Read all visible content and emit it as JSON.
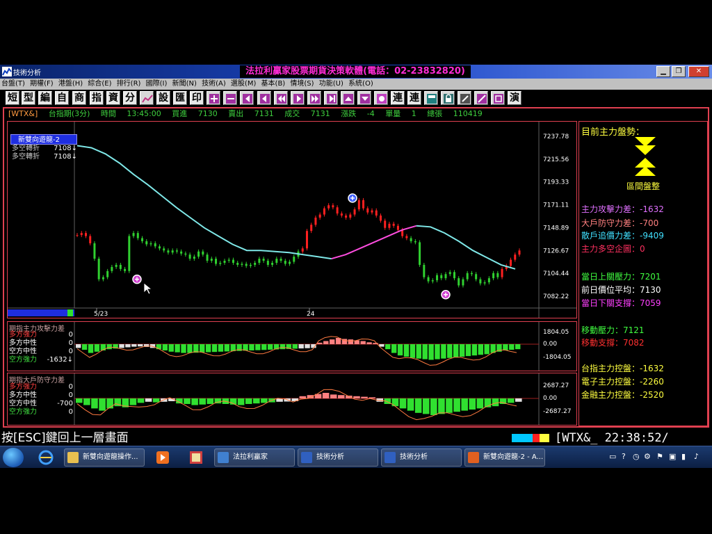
{
  "window": {
    "app_name": "技術分析",
    "title": "法拉利贏家股票期貨決策軟體(電話：02-23832820)"
  },
  "menu": [
    "台盤(T)",
    "期權(F)",
    "港盤(H)",
    "綜合(E)",
    "排行(R)",
    "國際(I)",
    "新聞(N)",
    "技術(A)",
    "選股(M)",
    "基本(B)",
    "情境(S)",
    "功能(U)",
    "系統(O)"
  ],
  "toolbar": {
    "text_buttons": [
      "短",
      "型",
      "編",
      "自",
      "商",
      "指",
      "資",
      "分"
    ],
    "text_buttons_2": [
      "設",
      "匯",
      "印"
    ],
    "text_buttons_3": [
      "連",
      "連"
    ],
    "text_buttons_4": [
      "演"
    ]
  },
  "info": {
    "code": "[WTX&]",
    "name": "台指期(3分)",
    "time_label": "時間",
    "time": "13:45:00",
    "buy_label": "買進",
    "buy": "7130",
    "sell_label": "賣出",
    "sell": "7131",
    "deal_label": "成交",
    "deal": "7131",
    "change_label": "漲跌",
    "change": "-4",
    "qty_label": "單量",
    "qty": "1",
    "total_label": "總張",
    "total": "110419"
  },
  "legend": {
    "indicator": "新雙向遊龍-2",
    "rows": [
      {
        "label": "多空轉折",
        "value": "7108↓"
      },
      {
        "label": "多空轉折",
        "value": "7108↓"
      }
    ]
  },
  "chart_data": [
    {
      "type": "line",
      "title": "",
      "y_ticks": [
        7237.78,
        7215.56,
        7193.33,
        7171.11,
        7148.89,
        7126.67,
        7104.44,
        7082.22
      ],
      "x_labels": [
        "5/23",
        "24"
      ],
      "series": [
        {
          "color": "#7fe8e8",
          "y": [
            7228,
            7226,
            7220,
            7211,
            7200,
            7190,
            7179,
            7168,
            7158,
            7148,
            7140,
            7132,
            7126,
            7126,
            7125,
            7124,
            7122,
            7120,
            7118
          ]
        },
        {
          "color": "#ff4de0",
          "y": [
            7118,
            7122,
            7128,
            7134,
            7140,
            7146,
            7150
          ]
        },
        {
          "color": "#7fe8e8",
          "y": [
            7150,
            7149,
            7143,
            7135,
            7126,
            7119,
            7112,
            7108
          ]
        }
      ],
      "price_path": [
        7141,
        7143,
        7140,
        7133,
        7118,
        7098,
        7100,
        7106,
        7110,
        7112,
        7108,
        7106,
        7140,
        7143,
        7138,
        7135,
        7132,
        7133,
        7130,
        7128,
        7126,
        7124,
        7126,
        7125,
        7123,
        7122,
        7118,
        7120,
        7125,
        7122,
        7116,
        7118,
        7113,
        7114,
        7116,
        7117,
        7114,
        7112,
        7113,
        7111,
        7112,
        7114,
        7118,
        7116,
        7112,
        7114,
        7118,
        7116,
        7113,
        7115,
        7120,
        7125,
        7128,
        7145,
        7151,
        7158,
        7161,
        7167,
        7170,
        7168,
        7162,
        7160,
        7158,
        7161,
        7166,
        7175,
        7167,
        7163,
        7165,
        7160,
        7155,
        7148,
        7152,
        7150,
        7146,
        7140,
        7138,
        7135,
        7134,
        7112,
        7100,
        7096,
        7097,
        7102,
        7099,
        7103,
        7105,
        7099,
        7092,
        7098,
        7104,
        7103,
        7098,
        7094,
        7095,
        7099,
        7104,
        7100,
        7108,
        7111,
        7117,
        7122,
        7126
      ]
    },
    {
      "type": "bar",
      "title": "期指主力攻擊力差",
      "y_ticks": [
        1804.05,
        0.0,
        -1804.05
      ],
      "rows": [
        {
          "label": "多方強力",
          "value": "0",
          "color": "#ff4040"
        },
        {
          "label": "多方中性",
          "value": "0",
          "color": "#ffffff"
        },
        {
          "label": "空方中性",
          "value": "0",
          "color": "#ffffff"
        },
        {
          "label": "空方強力",
          "value": "-1632↓",
          "color": "#40e040"
        }
      ],
      "values": [
        -300,
        -450,
        -700,
        -600,
        -500,
        -400,
        -350,
        -300,
        -250,
        -200,
        -180,
        -220,
        -300,
        -400,
        -500,
        -600,
        -650,
        -700,
        -700,
        -680,
        -660,
        -640,
        -620,
        -600,
        -580,
        -560,
        -540,
        -520,
        -500,
        -480,
        -460,
        -440,
        -420,
        -400,
        -380,
        -360,
        -340,
        -320,
        -300,
        120,
        250,
        380,
        500,
        420,
        380,
        300,
        250,
        150,
        100,
        -200,
        -400,
        -700,
        -900,
        -1000,
        -1100,
        -1150,
        -1200,
        -1250,
        -1200,
        -1150,
        -1100,
        -1050,
        -1000,
        -950,
        -900,
        -850,
        -800,
        -700,
        -600,
        -500,
        -450,
        -400
      ]
    },
    {
      "type": "bar",
      "title": "期指大戶防守力差",
      "y_ticks": [
        2687.27,
        0.0,
        -2687.27
      ],
      "rows": [
        {
          "label": "多方強力",
          "value": "0",
          "color": "#ff4040"
        },
        {
          "label": "多方中性",
          "value": "0",
          "color": "#ffffff"
        },
        {
          "label": "空方中性",
          "value": "-700",
          "color": "#ffffff"
        },
        {
          "label": "空方強力",
          "value": "0",
          "color": "#40e040"
        }
      ],
      "values": [
        -400,
        -600,
        -900,
        -1100,
        -900,
        -700,
        -800,
        -600,
        -400,
        -300,
        -350,
        -300,
        -250,
        -450,
        -500,
        -600,
        -550,
        -500,
        -450,
        -500,
        -550,
        -600,
        -500,
        -450,
        -400,
        -350,
        -300,
        -280,
        -250,
        200,
        300,
        400,
        500,
        350,
        300,
        250,
        200,
        150,
        100,
        -300,
        -500,
        -700,
        -900,
        -1100,
        -1300,
        -1400,
        -1500,
        -1400,
        -1300,
        -1200,
        -1100,
        -1000,
        -900,
        -800,
        -700,
        -500,
        -400,
        -300
      ]
    }
  ],
  "right_panel": {
    "heading": "目前主力盤勢：",
    "zone_label": "區間盤整",
    "items": [
      {
        "text": "主力攻擊力差：-1632",
        "color": "#e070ff"
      },
      {
        "text": "大戶防守力差：-700",
        "color": "#ff8080"
      },
      {
        "text": "散戶追價力差：-9409",
        "color": "#40e0ff"
      },
      {
        "text": "主力多空企圖：0",
        "color": "#ff3060"
      },
      {
        "text": "當日上關壓力：7201",
        "color": "#40ff40"
      },
      {
        "text": "前日價位平均：7130",
        "color": "#ffffff"
      },
      {
        "text": "當日下關支撐：7059",
        "color": "#ff40ff"
      },
      {
        "text": "移動壓力：7121",
        "color": "#40ff40"
      },
      {
        "text": "移動支撐：7082",
        "color": "#ff3030"
      },
      {
        "text": "台指主力控盤：-1632",
        "color": "#ffff40"
      },
      {
        "text": "電子主力控盤：-2260",
        "color": "#ffff40"
      },
      {
        "text": "金融主力控盤：-2520",
        "color": "#ffff40"
      }
    ]
  },
  "status": {
    "hint": "按[ESC]鍵回上一層畫面",
    "code": "[WTX&_",
    "clock": "22:38:52/"
  },
  "taskbar": {
    "items": [
      "新雙向遊龍操作...",
      "法拉利贏家",
      "技術分析",
      "技術分析",
      "新雙向遊龍-2 - A..."
    ]
  },
  "colors": {
    "bull": "#ff2020",
    "bear": "#30d030",
    "accent_border": "#e04050"
  }
}
